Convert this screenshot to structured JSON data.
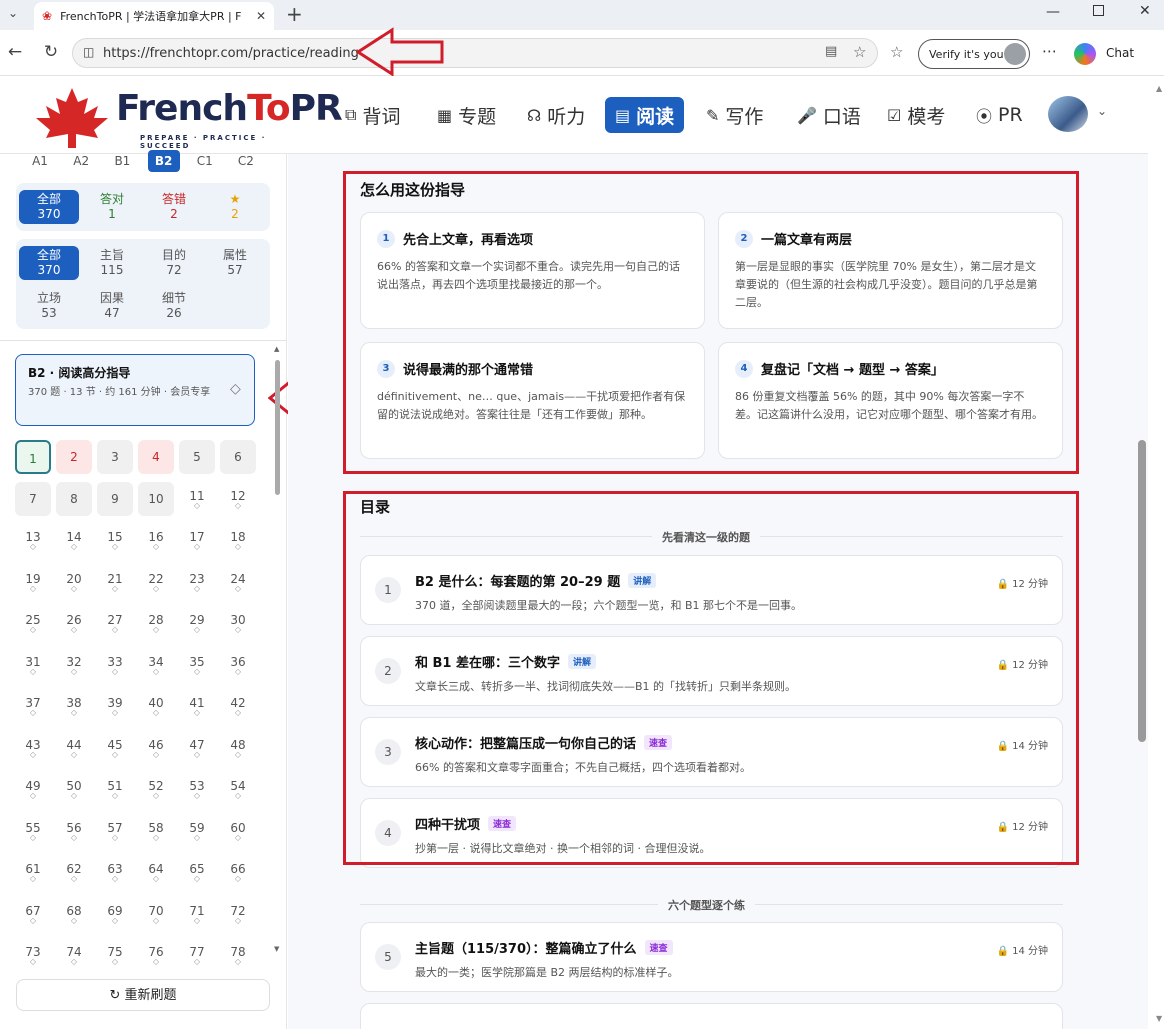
{
  "browser": {
    "tab_title": "FrenchToPR | 学法语拿加拿大PR | F",
    "url": "https://frenchtopr.com/practice/reading",
    "verify_label": "Verify it's you",
    "chat_label": "Chat"
  },
  "site": {
    "brand_part1": "French",
    "brand_part2": "To",
    "brand_part3": "PR",
    "tagline": "PREPARE · PRACTICE · SUCCEED",
    "nav": [
      {
        "label": "背词",
        "icon": "layers-icon"
      },
      {
        "label": "专题",
        "icon": "book-icon"
      },
      {
        "label": "听力",
        "icon": "headphones-icon"
      },
      {
        "label": "阅读",
        "icon": "document-icon",
        "active": true
      },
      {
        "label": "写作",
        "icon": "pen-icon"
      },
      {
        "label": "口语",
        "icon": "mic-icon"
      },
      {
        "label": "模考",
        "icon": "clipboard-icon"
      },
      {
        "label": "PR",
        "icon": "compass-icon"
      }
    ]
  },
  "sidebar": {
    "levels": [
      "A1",
      "A2",
      "B1",
      "B2",
      "C1",
      "C2"
    ],
    "active_level": "B2",
    "status_filters": [
      {
        "label": "全部",
        "count": "370",
        "active": true
      },
      {
        "label": "答对",
        "count": "1",
        "color": "#2e7d32"
      },
      {
        "label": "答错",
        "count": "2",
        "color": "#c62828"
      },
      {
        "label": "★",
        "count": "2",
        "color": "#e8a200"
      }
    ],
    "type_filters": [
      {
        "label": "全部",
        "count": "370",
        "active": true
      },
      {
        "label": "主旨",
        "count": "115"
      },
      {
        "label": "目的",
        "count": "72"
      },
      {
        "label": "属性",
        "count": "57"
      },
      {
        "label": "立场",
        "count": "53"
      },
      {
        "label": "因果",
        "count": "47"
      },
      {
        "label": "细节",
        "count": "26"
      }
    ],
    "guide": {
      "title": "B2 · 阅读高分指导",
      "subtitle": "370 题 · 13 节 · 约 161 分钟 · 会员专享"
    },
    "questions_unlocked": [
      "1",
      "2",
      "3",
      "4",
      "5",
      "6",
      "7",
      "8",
      "9",
      "10"
    ],
    "questions_locked": [
      "11",
      "12",
      "13",
      "14",
      "15",
      "16",
      "17",
      "18",
      "19",
      "20",
      "21",
      "22",
      "23",
      "24",
      "25",
      "26",
      "27",
      "28",
      "29",
      "30",
      "31",
      "32",
      "33",
      "34",
      "35",
      "36",
      "37",
      "38",
      "39",
      "40",
      "41",
      "42",
      "43",
      "44",
      "45",
      "46",
      "47",
      "48",
      "49",
      "50",
      "51",
      "52",
      "53",
      "54",
      "55",
      "56",
      "57",
      "58",
      "59",
      "60",
      "61",
      "62",
      "63",
      "64",
      "65",
      "66",
      "67",
      "68",
      "69",
      "70",
      "71",
      "72",
      "73",
      "74",
      "75",
      "76",
      "77",
      "78"
    ],
    "current_question": "1",
    "wrong_questions": [
      "2",
      "4"
    ],
    "reshuffle_label": "重新刷题"
  },
  "main": {
    "howto_title": "怎么用这份指导",
    "howto_cards": [
      {
        "num": "1",
        "title": "先合上文章，再看选项",
        "body": "66% 的答案和文章一个实词都不重合。读完先用一句自己的话说出落点，再去四个选项里找最接近的那一个。"
      },
      {
        "num": "2",
        "title": "一篇文章有两层",
        "body": "第一层是显眼的事实（医学院里 70% 是女生），第二层才是文章要说的（但生源的社会构成几乎没变）。题目问的几乎总是第二层。"
      },
      {
        "num": "3",
        "title": "说得最满的那个通常错",
        "body": "définitivement、ne… que、jamais——干扰项爱把作者有保留的说法说成绝对。答案往往是「还有工作要做」那种。"
      },
      {
        "num": "4",
        "title": "复盘记「文档 → 题型 → 答案」",
        "body": "86 份重复文档覆盖 56% 的题，其中 90% 每次答案一字不差。记这篇讲什么没用，记它对应哪个题型、哪个答案才有用。"
      }
    ],
    "toc_title": "目录",
    "toc_group1": "先看清这一级的题",
    "toc_group2": "六个题型逐个练",
    "toc_items": [
      {
        "num": "1",
        "title": "B2 是什么：每套题的第 20–29 题",
        "badge": "讲解",
        "badge_kind": "blue",
        "desc": "370 道，全部阅读题里最大的一段；六个题型一览，和 B1 那七个不是一回事。",
        "time": "12 分钟"
      },
      {
        "num": "2",
        "title": "和 B1 差在哪：三个数字",
        "badge": "讲解",
        "badge_kind": "blue",
        "desc": "文章长三成、转折多一半、找词彻底失效——B1 的「找转折」只剩半条规则。",
        "time": "12 分钟"
      },
      {
        "num": "3",
        "title": "核心动作：把整篇压成一句你自己的话",
        "badge": "速查",
        "badge_kind": "purple",
        "desc": "66% 的答案和文章零字面重合；不先自己概括，四个选项看着都对。",
        "time": "14 分钟"
      },
      {
        "num": "4",
        "title": "四种干扰项",
        "badge": "速查",
        "badge_kind": "purple",
        "desc": "抄第一层 · 说得比文章绝对 · 换一个相邻的词 · 合理但没说。",
        "time": "12 分钟"
      },
      {
        "num": "5",
        "title": "主旨题（115/370）：整篇确立了什么",
        "badge": "速查",
        "badge_kind": "purple",
        "desc": "最大的一类；医学院那篇是 B2 两层结构的标准样子。",
        "time": "14 分钟"
      }
    ]
  },
  "colors": {
    "accent": "#1d5fbe",
    "annotation_red": "#d11d2b"
  }
}
